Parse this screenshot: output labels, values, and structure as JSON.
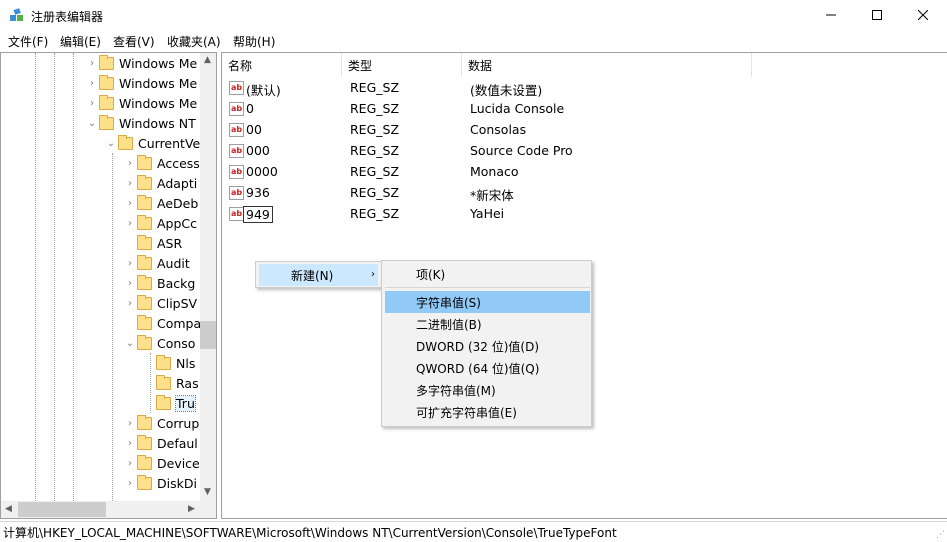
{
  "window": {
    "title": "注册表编辑器",
    "icon": "regedit-icon"
  },
  "menu": [
    "文件(F)",
    "编辑(E)",
    "查看(V)",
    "收藏夹(A)",
    "帮助(H)"
  ],
  "tree": [
    {
      "label": "Windows Me",
      "depth": 0,
      "expander": "collapsed"
    },
    {
      "label": "Windows Me",
      "depth": 0,
      "expander": "collapsed"
    },
    {
      "label": "Windows Me",
      "depth": 0,
      "expander": "collapsed"
    },
    {
      "label": "Windows NT",
      "depth": 0,
      "expander": "expanded"
    },
    {
      "label": "CurrentVe",
      "depth": 1,
      "expander": "expanded"
    },
    {
      "label": "Access",
      "depth": 2,
      "expander": "collapsed"
    },
    {
      "label": "Adapti",
      "depth": 2,
      "expander": "collapsed"
    },
    {
      "label": "AeDeb",
      "depth": 2,
      "expander": "collapsed"
    },
    {
      "label": "AppCc",
      "depth": 2,
      "expander": "collapsed"
    },
    {
      "label": "ASR",
      "depth": 2,
      "expander": "none"
    },
    {
      "label": "Audit",
      "depth": 2,
      "expander": "collapsed"
    },
    {
      "label": "Backg",
      "depth": 2,
      "expander": "collapsed"
    },
    {
      "label": "ClipSV",
      "depth": 2,
      "expander": "collapsed"
    },
    {
      "label": "Compa",
      "depth": 2,
      "expander": "none"
    },
    {
      "label": "Conso",
      "depth": 2,
      "expander": "expanded"
    },
    {
      "label": "Nls",
      "depth": 3,
      "expander": "none"
    },
    {
      "label": "Ras",
      "depth": 3,
      "expander": "none"
    },
    {
      "label": "Tru",
      "depth": 3,
      "expander": "none",
      "selected": true
    },
    {
      "label": "Corrup",
      "depth": 2,
      "expander": "collapsed"
    },
    {
      "label": "Defaul",
      "depth": 2,
      "expander": "collapsed"
    },
    {
      "label": "Device",
      "depth": 2,
      "expander": "collapsed"
    },
    {
      "label": "DiskDi",
      "depth": 2,
      "expander": "collapsed"
    }
  ],
  "list": {
    "headers": [
      "名称",
      "类型",
      "数据"
    ],
    "rows": [
      {
        "name": "(默认)",
        "type": "REG_SZ",
        "data": "(数值未设置)"
      },
      {
        "name": "0",
        "type": "REG_SZ",
        "data": "Lucida Console"
      },
      {
        "name": "00",
        "type": "REG_SZ",
        "data": "Consolas"
      },
      {
        "name": "000",
        "type": "REG_SZ",
        "data": "Source Code Pro"
      },
      {
        "name": "0000",
        "type": "REG_SZ",
        "data": "Monaco"
      },
      {
        "name": "936",
        "type": "REG_SZ",
        "data": "*新宋体"
      },
      {
        "name": "949",
        "type": "REG_SZ",
        "data": "YaHei",
        "editing": true
      }
    ]
  },
  "context_menu": {
    "new_label": "新建(N)",
    "submenu": [
      "项(K)",
      "字符串值(S)",
      "二进制值(B)",
      "DWORD (32 位)值(D)",
      "QWORD (64 位)值(Q)",
      "多字符串值(M)",
      "可扩充字符串值(E)"
    ],
    "highlighted": "字符串值(S)"
  },
  "status": "计算机\\HKEY_LOCAL_MACHINE\\SOFTWARE\\Microsoft\\Windows NT\\CurrentVersion\\Console\\TrueTypeFont",
  "colors": {
    "menu_highlight": "#91c9f7",
    "hover_highlight": "#cce8ff",
    "folder": "#ffe08a",
    "value_icon": "#d02020"
  }
}
